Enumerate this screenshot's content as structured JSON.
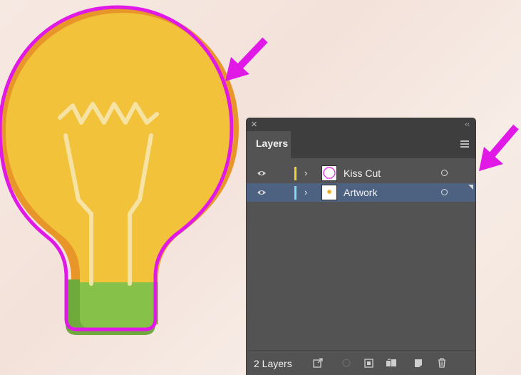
{
  "panel": {
    "title": "Layers",
    "layer_count_text": "2 Layers",
    "layers": [
      {
        "name": "Kiss Cut",
        "color": "#f2d52a",
        "selected": false
      },
      {
        "name": "Artwork",
        "color": "#7fd8f0",
        "selected": true
      }
    ]
  },
  "colors": {
    "annotation_arrow": "#e019e6",
    "bulb_yellow": "#f2c23a",
    "bulb_orange": "#e8962a",
    "bulb_base_green": "#86c24a",
    "cut_outline": "#e019e6",
    "selection_blue": "#4d6281"
  },
  "icons": {
    "panel": [
      "close-icon",
      "collapse-icon",
      "panel-menu-icon",
      "eye-icon",
      "chevron-right-icon",
      "target-circle-icon"
    ],
    "footer": [
      "collect-export-icon",
      "make-clipping-mask-icon",
      "create-sublayer-icon",
      "create-new-layer-icon",
      "new-layer-icon",
      "delete-icon"
    ]
  }
}
